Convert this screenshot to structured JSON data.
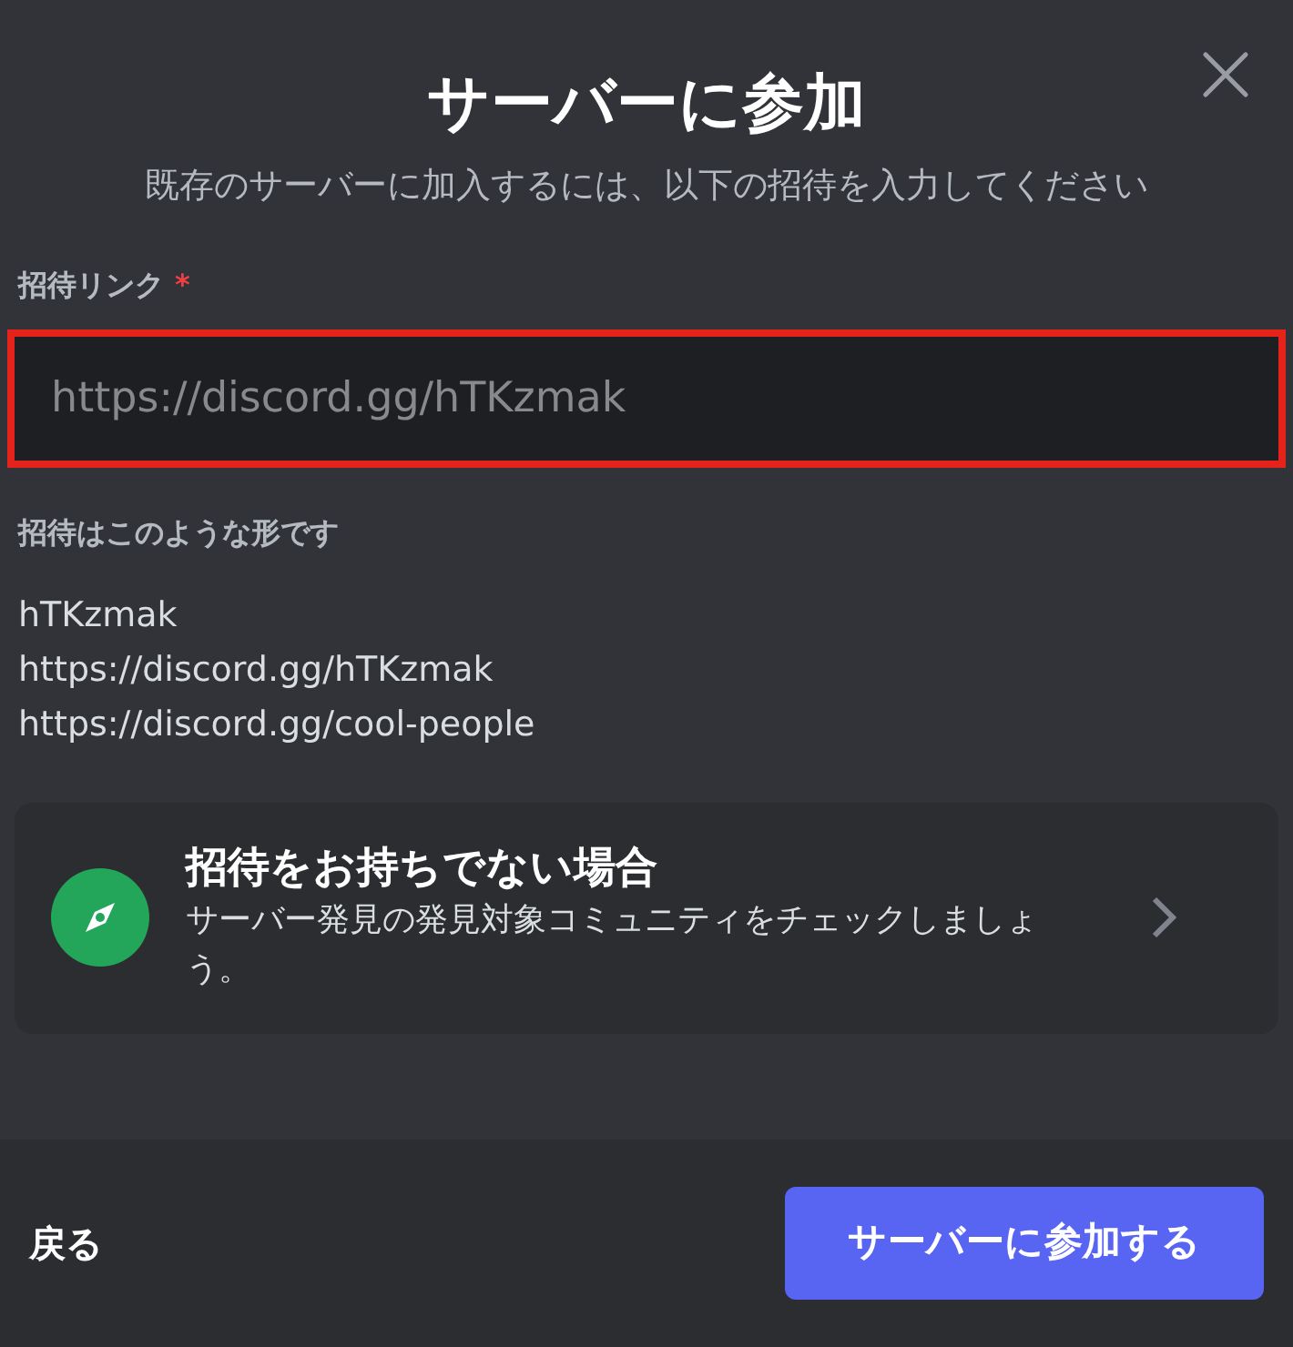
{
  "dialog": {
    "title": "サーバーに参加",
    "subtitle": "既存のサーバーに加入するには、以下の招待を入力してください"
  },
  "invite_field": {
    "label": "招待リンク",
    "required_mark": "*",
    "placeholder": "https://discord.gg/hTKzmak",
    "highlighted": true
  },
  "examples": {
    "heading": "招待はこのような形です",
    "items": [
      "hTKzmak",
      "https://discord.gg/hTKzmak",
      "https://discord.gg/cool-people"
    ]
  },
  "discover_card": {
    "title": "招待をお持ちでない場合",
    "description": "サーバー発見の発見対象コミュニティをチェックしましょう。"
  },
  "footer": {
    "back": "戻る",
    "submit": "サーバーに参加する"
  }
}
